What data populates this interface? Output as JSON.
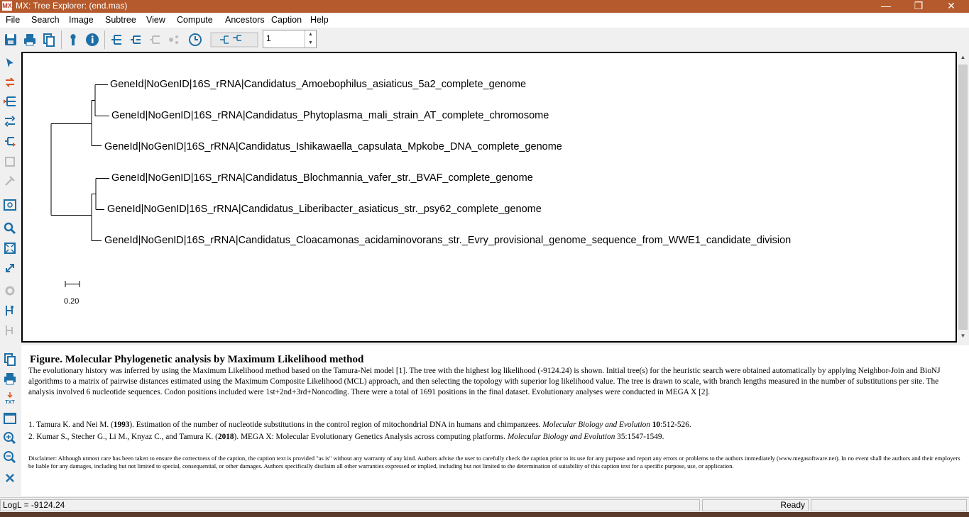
{
  "window": {
    "app_icon_text": "MX",
    "title": "MX: Tree Explorer: (end.mas)",
    "minimize": "—",
    "restore": "❐",
    "close": "✕"
  },
  "menu": [
    "File",
    "Search",
    "Image",
    "Subtree",
    "View",
    "Compute",
    "Ancestors",
    "Caption",
    "Help"
  ],
  "toolbar": {
    "tree_count_value": "1",
    "spin_up": "▲",
    "spin_down": "▼"
  },
  "tree": {
    "taxa": [
      "GeneId|NoGenID|16S_rRNA|Candidatus_Amoebophilus_asiaticus_5a2_complete_genome",
      "GeneId|NoGenID|16S_rRNA|Candidatus_Phytoplasma_mali_strain_AT_complete_chromosome",
      "GeneId|NoGenID|16S_rRNA|Candidatus_Ishikawaella_capsulata_Mpkobe_DNA_complete_genome",
      "GeneId|NoGenID|16S_rRNA|Candidatus_Blochmannia_vafer_str._BVAF_complete_genome",
      "GeneId|NoGenID|16S_rRNA|Candidatus_Liberibacter_asiaticus_str._psy62_complete_genome",
      "GeneId|NoGenID|16S_rRNA|Candidatus_Cloacamonas_acidaminovorans_str._Evry_provisional_genome_sequence_from_WWE1_candidate_division"
    ],
    "scale_label": "0.20"
  },
  "scroll": {
    "up": "▲",
    "down": "▼"
  },
  "caption": {
    "title": "Figure. Molecular Phylogenetic analysis by Maximum Likelihood method",
    "body": "The evolutionary history was inferred by using the Maximum Likelihood method based on the Tamura-Nei model [1]. The tree with the highest log likelihood (-9124.24) is shown. Initial tree(s) for the heuristic search were obtained automatically by applying Neighbor-Join and BioNJ algorithms to a matrix of pairwise distances estimated using the Maximum Composite Likelihood (MCL) approach, and then selecting the topology with superior log likelihood value. The tree is drawn to scale, with branch lengths measured in the number of substitutions per site. The analysis involved 6 nucleotide sequences. Codon positions included were 1st+2nd+3rd+Noncoding. There were a total of 1691 positions in the final dataset. Evolutionary analyses were conducted in MEGA X [2].",
    "ref1": {
      "lead": "1. Tamura K. and Nei M. (",
      "year": "1993",
      "mid": "). Estimation of the number of nucleotide substitutions in the control region of mitochondrial DNA in humans and chimpanzees. ",
      "journal": "Molecular Biology and Evolution",
      "vol": " 10",
      "pages": ":512-526."
    },
    "ref2": {
      "lead": "2. Kumar S., Stecher G., Li M., Knyaz C., and Tamura K. (",
      "year": "2018",
      "mid": "). MEGA X: Molecular Evolutionary Genetics Analysis across computing platforms. ",
      "journal": "Molecular Biology and Evolution",
      "tail": " 35:1547-1549."
    },
    "disclaimer": "Disclaimer: Although utmost care has been taken to ensure the correctness of the caption, the caption text is provided \"as is\" without any warranty of any kind. Authors advise the user to carefully check the caption prior to its use for any purpose and report any errors or problems to the authors immediately (www.megasoftware.net). In no event shall the authors and their employers be liable for any damages, including but not limited to special, consequential, or other damages. Authors specifically disclaim all other warranties expressed or implied, including but not limited to the determination of suitability of this caption text for a specific purpose, use, or application."
  },
  "leftcap_txt_label": "TXT",
  "status": {
    "logl": "LogL = -9124.24",
    "state": "Ready"
  }
}
